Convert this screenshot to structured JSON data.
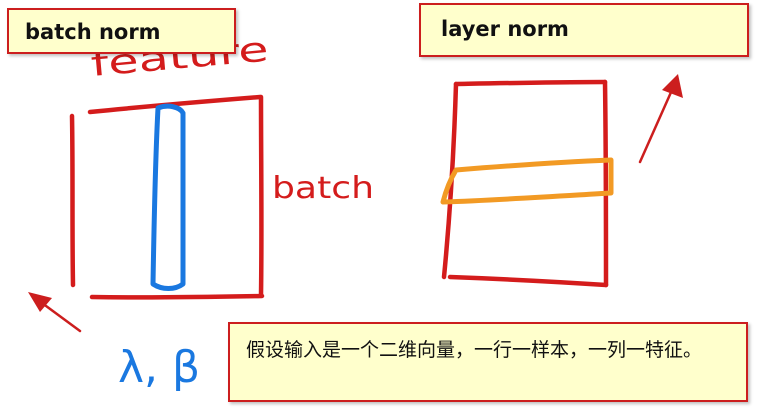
{
  "notes": {
    "batch_norm_title": "batch norm",
    "layer_norm_title": "layer norm",
    "description": "假设输入是一个二维向量，一行一样本，一列一特征。"
  },
  "handwriting": {
    "feature_label": "feature",
    "batch_label": "batch",
    "params_label": "λ, β"
  },
  "colors": {
    "ink_red": "#d41c1c",
    "ink_blue": "#1a78e0",
    "ink_orange": "#f29a24",
    "note_fill": "#ffffcc",
    "note_border": "#cc1e1e"
  }
}
